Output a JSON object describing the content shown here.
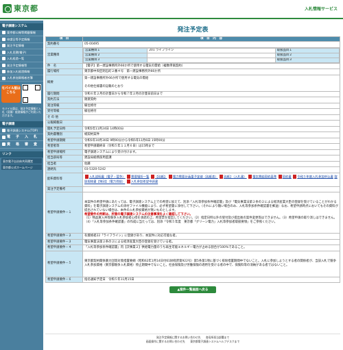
{
  "header": {
    "logo": "東京都",
    "service": "入札情報サービス"
  },
  "sidebar": {
    "section1": "電子調達システム",
    "items": [
      "東京都公報等掲載情報",
      "申請日等予定情報",
      "発注予定情報",
      "入札見積(電子)",
      "入札経過一覧",
      "発注予定情報等",
      "参加入札経過情報",
      "入札参加資格者名簿"
    ],
    "mobile": "モバイル版はこちら",
    "mobile_note": "モバイル版は、発注予定情報と入札（見積）経過情報がご利用いただけます。",
    "section2": "電子調達",
    "items2": [
      "電子調達システム(TOP)",
      "電　子　入　札",
      "資　格　審　査"
    ],
    "section3": "リンク",
    "links": [
      "東京電子自治体共同運営",
      "東京都公式ホームページ"
    ]
  },
  "page_title": "発注予定表",
  "table": {
    "col1": "項　目",
    "col2": "項　目　内　容",
    "rows": [
      {
        "label": "契約番号",
        "value": "05-00495"
      },
      {
        "label": "営業種目",
        "sub": [
          "営業種目１",
          "営業種目２",
          "営業種目３"
        ],
        "subval": [
          "201 ライフライン",
          "",
          ""
        ],
        "rank": [
          "取扱品目１",
          "取扱品目２",
          "取扱品目３"
        ]
      },
      {
        "label": "件　名",
        "value": "【電子】第一建設事務所外66か所で使用する電気の需給（複数単価契約）"
      },
      {
        "label": "履行場所",
        "value": "東京都中央区明石町２番４号　第一建設事務所外66か所"
      },
      {
        "label": "概要",
        "value": "第一建設事務所外66か所で使用する電気の需給\n\nその他仕様書の記載のとおり"
      },
      {
        "label": "履行期間",
        "value": "令和６年２月の計量日から令和７年２月の計量日前日まで"
      },
      {
        "label": "契約方法",
        "value": "随意契約"
      },
      {
        "label": "発注等級",
        "value": "級位格付"
      },
      {
        "label": "受付等級",
        "value": "級位格付"
      },
      {
        "label": "そ の 他",
        "value": ""
      },
      {
        "label": "公報掲載日",
        "value": ""
      },
      {
        "label": "開札予定日時",
        "value": "令和5年11月24日 14時00分"
      },
      {
        "label": "契約書種別",
        "value": "紙契約案件"
      },
      {
        "label": "希望申請期間",
        "value": "令和5年10月30日 9時00分から令和5年11月6日 15時00分"
      },
      {
        "label": "希望者等",
        "value": "希望申請最終日（令和５年１１月６日）は15時まで"
      },
      {
        "label": "希望申請場所",
        "value": "電子調達システムにより受け付けます。"
      },
      {
        "label": "担当部局等",
        "value": "建設局総務部用度課"
      },
      {
        "label": "担当者",
        "value": "佐藤"
      },
      {
        "label": "連絡先",
        "value": "03-5320-5242"
      }
    ],
    "docs_label": "配布資料等",
    "docs": [
      "入札説明書（電子・競争）",
      "需要場所一覧",
      "【別紙】",
      "電力需要計画量予定値（別紙表）",
      "別紙2（入札書）",
      "電気需給契約基準",
      "契約書",
      "令和５年度入札参加申込書",
      "取扱規格書【特別】（電力供給）",
      "入札参加希望申請書"
    ],
    "conditions_label": "発注予定備考",
    "req_label": "希望申請要件",
    "req1": "本案件の希望申請にあたっては、電子調達システム上での希望に加えて、別添「入札等参加条件確認書」及び「電気事業法第２条の２による経済産業大臣の登録を受けていることがわかる資料」を電子調達システムの添付ファイル機能により、必ず希望書に添付して下さい。（それにより難い場合のみ、入札等参加条件確認書を郵送）なお、希望申請時点においてもその資料が提出されていない場合は、本件の入札参加資格が無いものとします。",
    "req1b": "希望要件の判断は、所管の電子調達システムの注意事項をよく確認して下さい。",
    "req1c": "（1）物品買入共等競争入札参加者心得を承諾の上、希望票を提出してください。（2）指定日時以外の受付及び提出後の案件変更等はできません。（3）希望申請の取り消しはできません。（4）「入札等参加条件確認書」の作成に当たっては、別添「令和５年度　東京都「グリーン電力」入札等参加者取扱要領」をご参照ください。",
    "req2": "有資格者22「ライフライン」に登録があり、本案件に対応可能な者。",
    "req3": "電気事業法第２条の２による経済産業大臣の登録を受けている者。",
    "req4": "「入札等参加条件確認書」内【次事業２】供給電力量のうち再生可能エネルギー電力が占める割合が100%であること。",
    "req5": "東京都契約関係暴力団等対策措置要綱（昭和62年1月14日付61財経庶第922号）第5条第1項に基づく排除措置期間中でないこと。入札に参加しようとする者の関係者が、当該入札で競争入札参加資格（東京都競争入札資格）停止期間中でないこと。社会保険及び労働保険の適用を受ける者の中で、保険料等の滞納がある者ではないこと。",
    "req6": "指名通知予定日　令和５年11月15日"
  },
  "back_button": "▲案件一覧画面へ戻る",
  "footer": {
    "line1": "発注予定情報に関するお問い合わせ先　　各局所担当部署まで",
    "line2": "画面操作に関するお問い合わせ先　　東京都電子調達システムヘルプデスクまで"
  }
}
